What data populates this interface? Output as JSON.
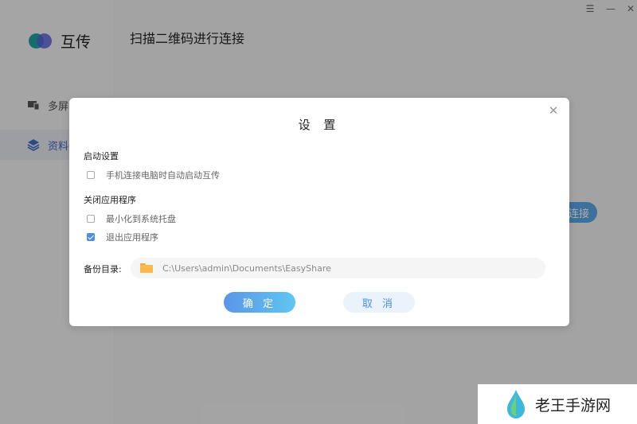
{
  "app": {
    "name": "互传",
    "header_title": "扫描二维码进行连接",
    "nav": [
      {
        "label": "多屏协同"
      },
      {
        "label": "资料备份"
      }
    ],
    "connect_label": "连接",
    "window_controls": [
      "menu-icon",
      "minimize-icon",
      "close-icon"
    ]
  },
  "dialog": {
    "title": "设 置",
    "startup_section": "启动设置",
    "startup_option": "手机连接电脑时自动启动互传",
    "startup_checked": false,
    "close_section": "关闭应用程序",
    "close_options": [
      {
        "label": "最小化到系统托盘",
        "checked": false
      },
      {
        "label": "退出应用程序",
        "checked": true
      }
    ],
    "backup_dir_label": "备份目录:",
    "backup_dir_value": "C:\\Users\\admin\\Documents\\EasyShare",
    "ok_label": "确 定",
    "cancel_label": "取 消"
  },
  "watermark": {
    "text": "老王手游网"
  },
  "colors": {
    "accent": "#4a8ee8",
    "folder": "#fbb94a"
  }
}
